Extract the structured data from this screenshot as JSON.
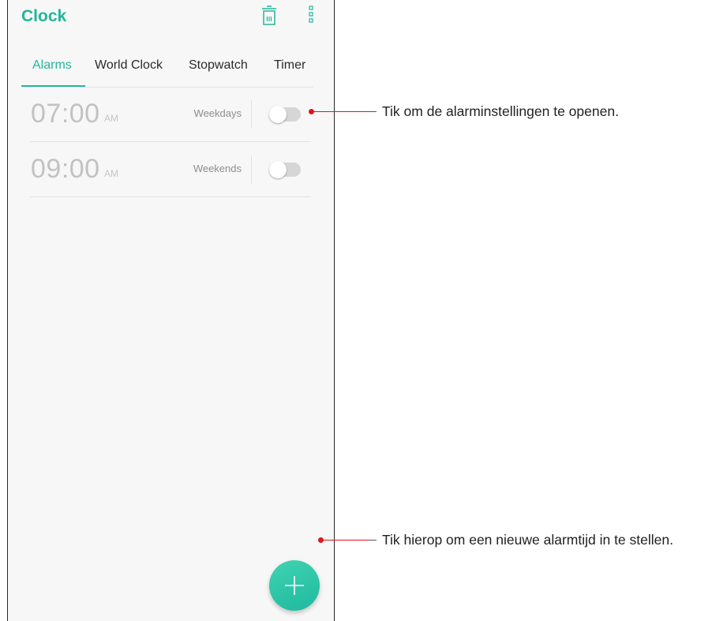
{
  "app": {
    "title": "Clock"
  },
  "toolbar": {
    "delete_icon": "trash-icon",
    "menu_icon": "more-vertical-icon"
  },
  "tabs": [
    {
      "label": "Alarms",
      "active": true
    },
    {
      "label": "World Clock",
      "active": false
    },
    {
      "label": "Stopwatch",
      "active": false
    },
    {
      "label": "Timer",
      "active": false
    }
  ],
  "alarms": [
    {
      "time": "07:00",
      "ampm": "AM",
      "repeat": "Weekdays",
      "enabled": false
    },
    {
      "time": "09:00",
      "ampm": "AM",
      "repeat": "Weekends",
      "enabled": false
    }
  ],
  "fab": {
    "icon": "plus-icon"
  },
  "callouts": {
    "alarm_settings": "Tik om de alarminstellingen te openen.",
    "add_alarm": "Tik hierop om een nieuwe alarmtijd in te stellen."
  },
  "colors": {
    "accent": "#23b59b",
    "callout": "#e0141d",
    "fab": "#2cc4a6"
  }
}
